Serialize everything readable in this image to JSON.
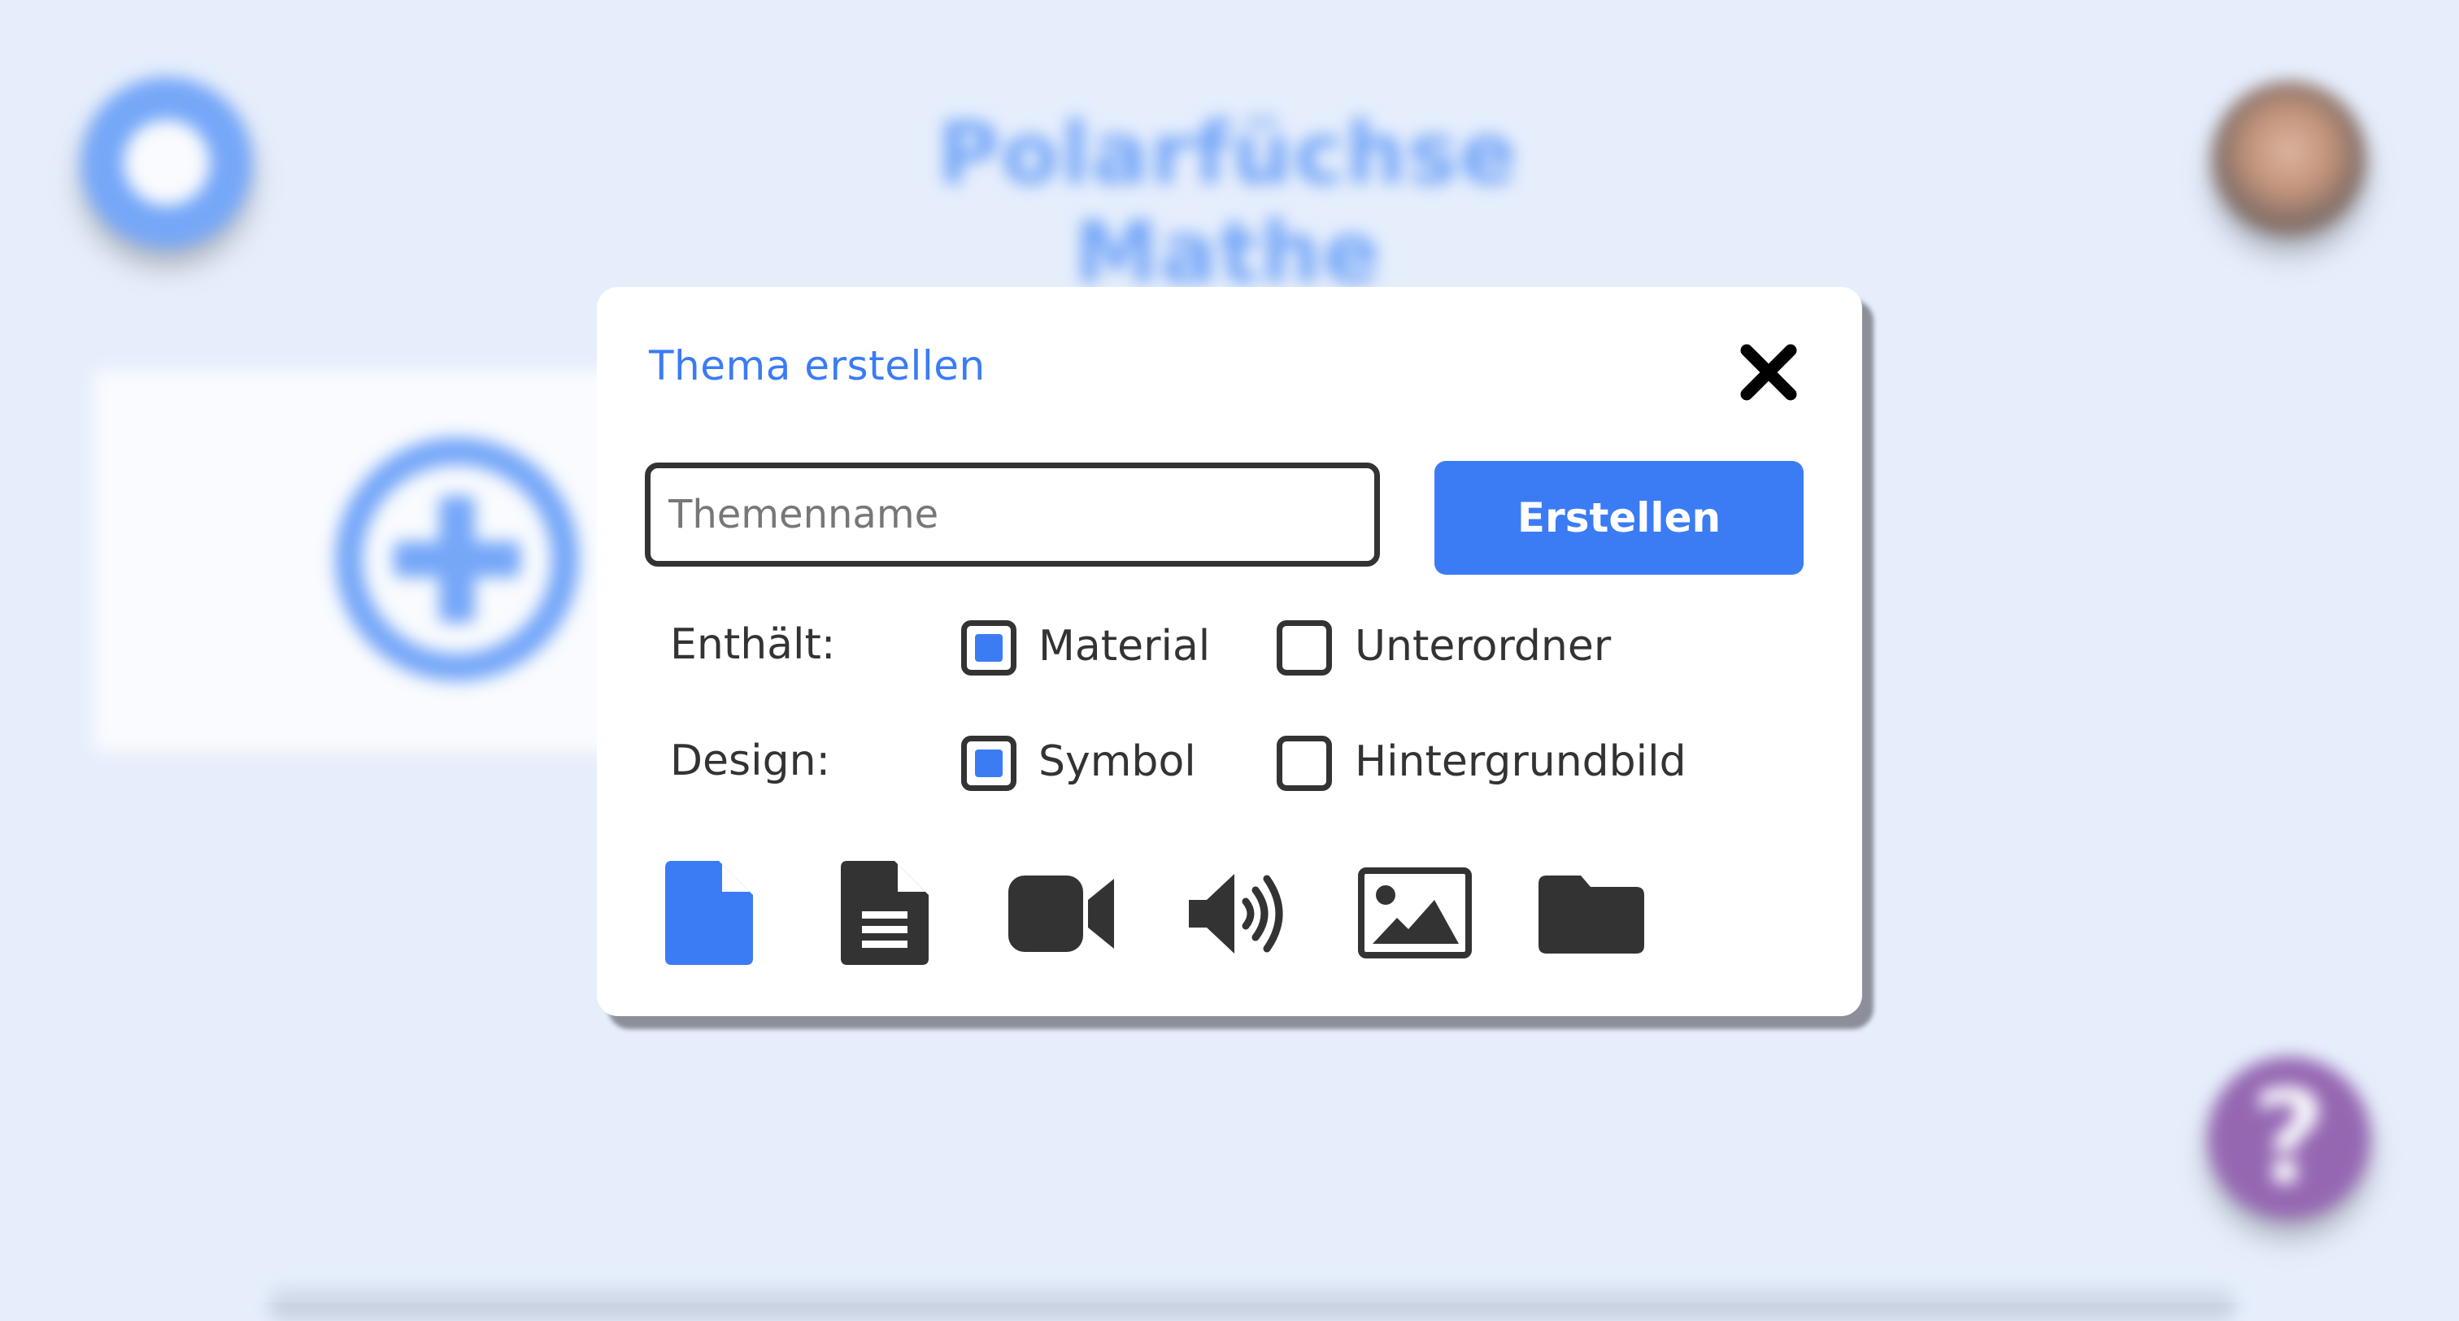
{
  "background": {
    "page_title": "Polarfüchse Mathe",
    "help_symbol": "?"
  },
  "dialog": {
    "title": "Thema erstellen",
    "name_input": {
      "placeholder": "Themenname",
      "value": ""
    },
    "create_label": "Erstellen",
    "contains": {
      "label": "Enthält:",
      "options": [
        {
          "label": "Material",
          "checked": true
        },
        {
          "label": "Unterordner",
          "checked": false
        }
      ]
    },
    "design": {
      "label": "Design:",
      "options": [
        {
          "label": "Symbol",
          "checked": true
        },
        {
          "label": "Hintergrundbild",
          "checked": false
        }
      ]
    },
    "type_icons": [
      {
        "name": "file-icon",
        "selected": true
      },
      {
        "name": "document-icon",
        "selected": false
      },
      {
        "name": "video-icon",
        "selected": false
      },
      {
        "name": "audio-icon",
        "selected": false
      },
      {
        "name": "image-icon",
        "selected": false
      },
      {
        "name": "folder-icon",
        "selected": false
      }
    ]
  },
  "colors": {
    "accent": "#3b7cf5",
    "text": "#333333",
    "page_background": "#e6eefc",
    "help_button": "#7a3a9a"
  }
}
